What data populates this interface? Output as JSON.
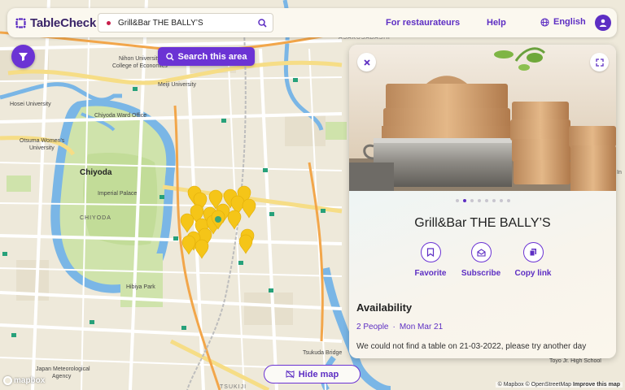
{
  "header": {
    "brand": "TableCheck",
    "search_query": "Grill&Bar THE BALLY’S",
    "for_restaurateurs": "For restaurateurs",
    "help": "Help",
    "language": "English"
  },
  "map": {
    "search_area_label": "Search this area",
    "hide_map_label": "Hide map",
    "mapbox_label": "mapbox",
    "attribution": "© Mapbox © OpenStreetMap",
    "improve_label": "Improve this map",
    "places": [
      "Chiyoda",
      "CHIYODA",
      "Imperial Palace",
      "Nihon University",
      "College of Economics",
      "Meiji University",
      "Hosei University",
      "Chiyoda Ward Office",
      "Otsuma Women's",
      "University",
      "Hibiya Park",
      "Japan Meteorological",
      "Agency",
      "ASAKUSABASHI",
      "Tsukuda Bridge",
      "Toyo Jr. High School",
      "TSUKIJI"
    ],
    "pin_color": "#f5c518",
    "accent_color": "#6b33d4"
  },
  "restaurant_card": {
    "name": "Grill&Bar THE BALLY’S",
    "photo_count": 8,
    "active_photo": 2,
    "actions": [
      {
        "label": "Favorite",
        "icon": "bookmark-icon"
      },
      {
        "label": "Subscribe",
        "icon": "mail-icon"
      },
      {
        "label": "Copy link",
        "icon": "copy-icon"
      }
    ],
    "availability": {
      "title": "Availability",
      "people": "2 People",
      "separator": "·",
      "date": "Mon Mar 21",
      "message": "We could not find a table on 21-03-2022, please try another day"
    }
  }
}
